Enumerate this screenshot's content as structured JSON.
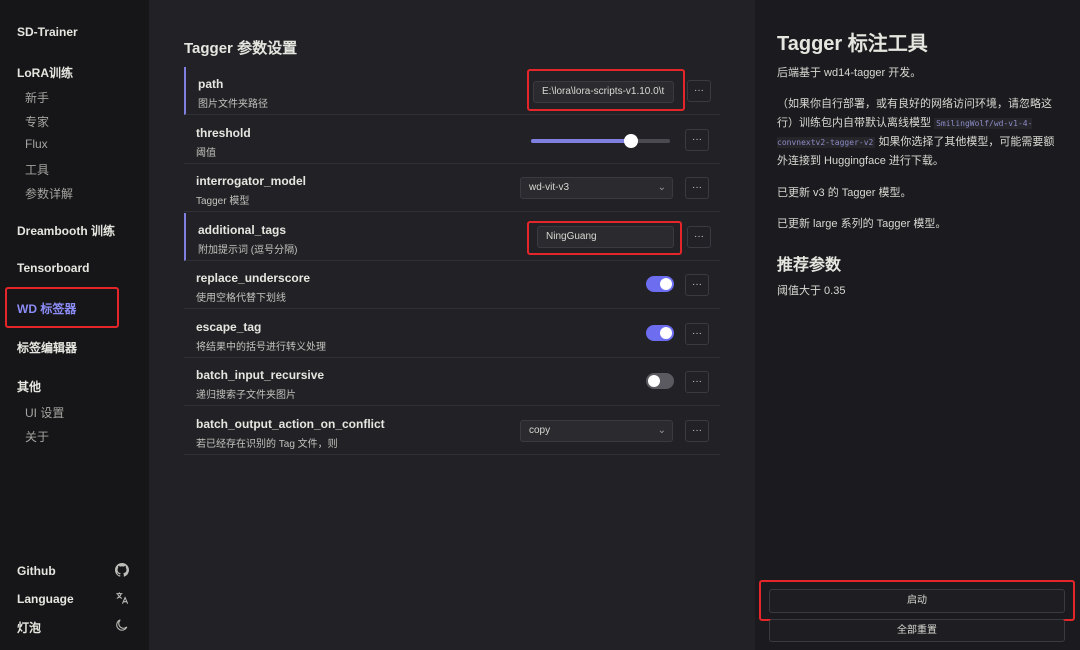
{
  "sidebar": {
    "brand": "SD-Trainer",
    "lora_group": "LoRA训练",
    "lora_items": [
      "新手",
      "专家",
      "Flux",
      "工具",
      "参数详解"
    ],
    "dreambooth": "Dreambooth 训练",
    "tensorboard": "Tensorboard",
    "wd_tagger": "WD 标签器",
    "tag_editor": "标签编辑器",
    "other_group": "其他",
    "other_items": [
      "UI 设置",
      "关于"
    ],
    "footer": {
      "github": "Github",
      "language": "Language",
      "theme": "灯泡"
    }
  },
  "main": {
    "title": "Tagger 参数设置",
    "more_label": "···",
    "params": [
      {
        "name": "path",
        "desc": "图片文件夹路径",
        "value": "E:\\lora\\lora-scripts-v1.10.0\\t"
      },
      {
        "name": "threshold",
        "desc": "阈值",
        "value": 0.35,
        "fraction": 0.35
      },
      {
        "name": "interrogator_model",
        "desc": "Tagger 模型",
        "value": "wd-vit-v3"
      },
      {
        "name": "additional_tags",
        "desc": "附加提示词 (逗号分隔)",
        "value": "NingGuang"
      },
      {
        "name": "replace_underscore",
        "desc": "使用空格代替下划线",
        "value": true
      },
      {
        "name": "escape_tag",
        "desc": "将结果中的括号进行转义处理",
        "value": true
      },
      {
        "name": "batch_input_recursive",
        "desc": "递归搜索子文件夹图片",
        "value": false
      },
      {
        "name": "batch_output_action_on_conflict",
        "desc": "若已经存在识别的 Tag 文件，则",
        "value": "copy"
      }
    ]
  },
  "right": {
    "title": "Tagger 标注工具",
    "p1": "后端基于 wd14-tagger 开发。",
    "p2_a": "（如果你自行部署，或有良好的网络访问环境，请忽略这行）训练包内自带默认离线模型",
    "p2_code": "SmilingWolf/wd-v1-4-convnextv2-tagger-v2",
    "p2_b": "如果你选择了其他模型，可能需要额外连接到 Huggingface 进行下载。",
    "p3": "已更新 v3 的 Tagger 模型。",
    "p4": "已更新 large 系列的 Tagger 模型。",
    "sub_title": "推荐参数",
    "p5": "阈值大于 0.35",
    "start_button": "启动",
    "reset_button": "全部重置"
  },
  "colors": {
    "accent": "#7f7fe0",
    "toggle_on": "#6d6df0",
    "highlight_box": "#e4262a",
    "active_nav": "#8c8cf7"
  }
}
